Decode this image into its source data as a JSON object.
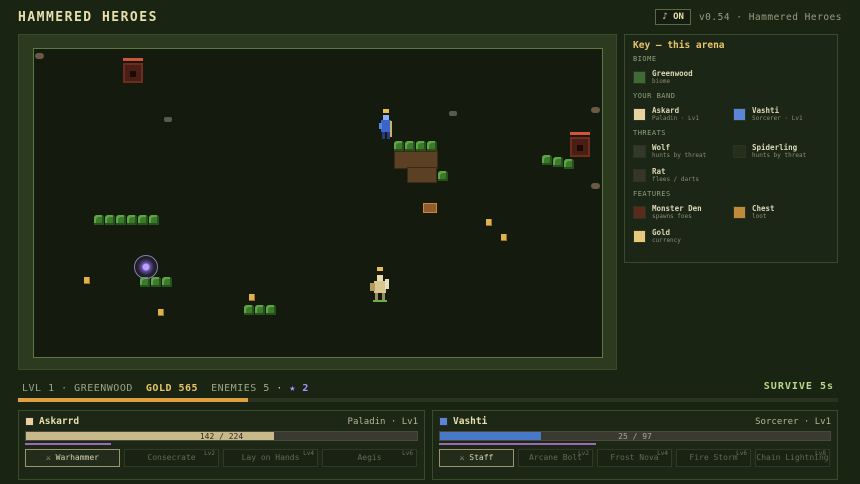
{
  "game": {
    "title": "HAMMERED HEROES",
    "music_button": "♪ ON",
    "version": "v0.54 · Hammered Heroes"
  },
  "key": {
    "title": "Key — this arena",
    "sections": {
      "biome": "BIOME",
      "band": "YOUR BAND",
      "threats": "THREATS",
      "features": "FEATURES"
    },
    "biome": [
      {
        "name": "Greenwood",
        "sub": "biome",
        "color": "#3f6a34"
      }
    ],
    "band": [
      {
        "name": "Askard",
        "sub": "Paladin · Lv1",
        "color": "#e8d2a0"
      },
      {
        "name": "Vashti",
        "sub": "Sorcerer · Lv1",
        "color": "#5a86d8"
      }
    ],
    "threats": [
      {
        "name": "Wolf",
        "sub": "hunts by threat",
        "color": "#33382a"
      },
      {
        "name": "Spiderling",
        "sub": "hunts by threat",
        "color": "#25301c"
      },
      {
        "name": "Rat",
        "sub": "flees / darts",
        "color": "#3a3428"
      }
    ],
    "features": [
      {
        "name": "Monster Den",
        "sub": "spawns foes",
        "color": "#5a2a1c"
      },
      {
        "name": "Chest",
        "sub": "loot",
        "color": "#c08a3a"
      },
      {
        "name": "Gold",
        "sub": "currency",
        "color": "#e8c87a"
      }
    ]
  },
  "status": {
    "level": "LVL 1",
    "biome": "GREENWOOD",
    "gold": "GOLD 565",
    "enemies": "ENEMIES 5",
    "star": "★ 2",
    "survive": "SURVIVE 5s",
    "xp_fraction": 0.28
  },
  "heroes": [
    {
      "name": "Askarrd",
      "class": "Paladin · Lv1",
      "color": "#e8d2a0",
      "hp_text": "142 / 224",
      "hp_fraction": 0.634,
      "hp_color": "#c8b98a",
      "mp_color": "#9a6ab8",
      "skills": [
        {
          "label": "⚔ Warhammer",
          "lv": "",
          "active": true
        },
        {
          "label": "Consecrate",
          "lv": "Lv2",
          "active": false
        },
        {
          "label": "Lay on Hands",
          "lv": "Lv4",
          "active": false
        },
        {
          "label": "Aegis",
          "lv": "Lv6",
          "active": false
        }
      ]
    },
    {
      "name": "Vashti",
      "class": "Sorcerer · Lv1",
      "color": "#5a86d8",
      "hp_text": "25 / 97",
      "hp_fraction": 0.258,
      "hp_color": "#4a78c8",
      "mp_color": "#9a6ab8",
      "skills": [
        {
          "label": "⚔ Staff",
          "lv": "",
          "active": true
        },
        {
          "label": "Arcane Bolt",
          "lv": "Lv2",
          "active": false
        },
        {
          "label": "Frost Nova",
          "lv": "Lv4",
          "active": false
        },
        {
          "label": "Fire Storm",
          "lv": "Lv6",
          "active": false
        },
        {
          "label": "Chain Lightning",
          "lv": "Lv8",
          "active": false
        }
      ]
    }
  ]
}
